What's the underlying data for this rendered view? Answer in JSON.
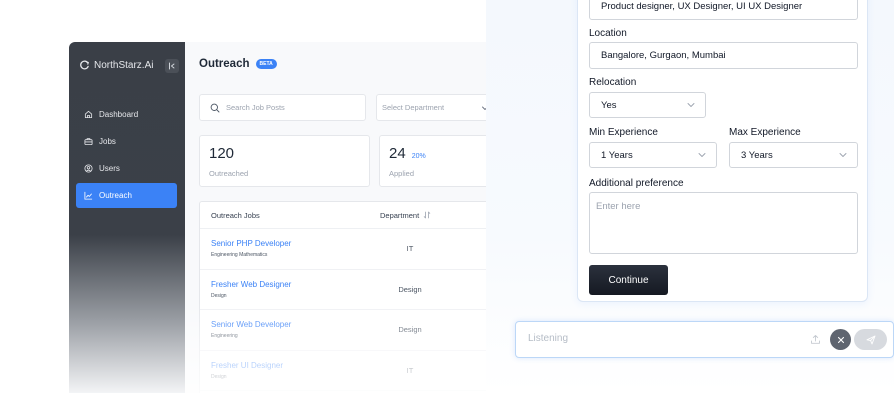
{
  "app": {
    "brand": "NorthStarz.Ai",
    "nav": [
      {
        "label": "Dashboard",
        "icon": "home-icon"
      },
      {
        "label": "Jobs",
        "icon": "briefcase-icon"
      },
      {
        "label": "Users",
        "icon": "user-icon"
      },
      {
        "label": "Outreach",
        "icon": "chart-icon",
        "active": true
      }
    ],
    "page_title": "Outreach",
    "beta_badge": "BETA",
    "search_placeholder": "Search Job Posts",
    "department_placeholder": "Select Department",
    "stats": [
      {
        "value": "120",
        "label": "Outreached",
        "percent": ""
      },
      {
        "value": "24",
        "label": "Applied",
        "percent": "20%"
      }
    ],
    "table": {
      "headers": [
        "Outreach Jobs",
        "Department"
      ],
      "rows": [
        {
          "title": "Senior PHP Developer",
          "subtitle": "Engineering Mathematics",
          "department": "IT"
        },
        {
          "title": "Fresher Web Designer",
          "subtitle": "Design",
          "department": "Design"
        },
        {
          "title": "Senior Web Developer",
          "subtitle": "Engineering",
          "department": "Design"
        },
        {
          "title": "Fresher UI Designer",
          "subtitle": "Design",
          "department": "IT"
        }
      ]
    },
    "colors": {
      "accent": "#3b82f6",
      "sidebar": "#3a3f47"
    }
  },
  "form": {
    "roles_value": "Product designer, UX Designer, UI UX Designer",
    "location_label": "Location",
    "location_value": "Bangalore, Gurgaon, Mumbai",
    "relocation_label": "Relocation",
    "relocation_value": "Yes",
    "min_exp_label": "Min Experience",
    "min_exp_value": "1 Years",
    "max_exp_label": "Max Experience",
    "max_exp_value": "3 Years",
    "additional_label": "Additional preference",
    "additional_placeholder": "Enter here",
    "continue_label": "Continue"
  },
  "chat": {
    "placeholder": "Listening"
  }
}
